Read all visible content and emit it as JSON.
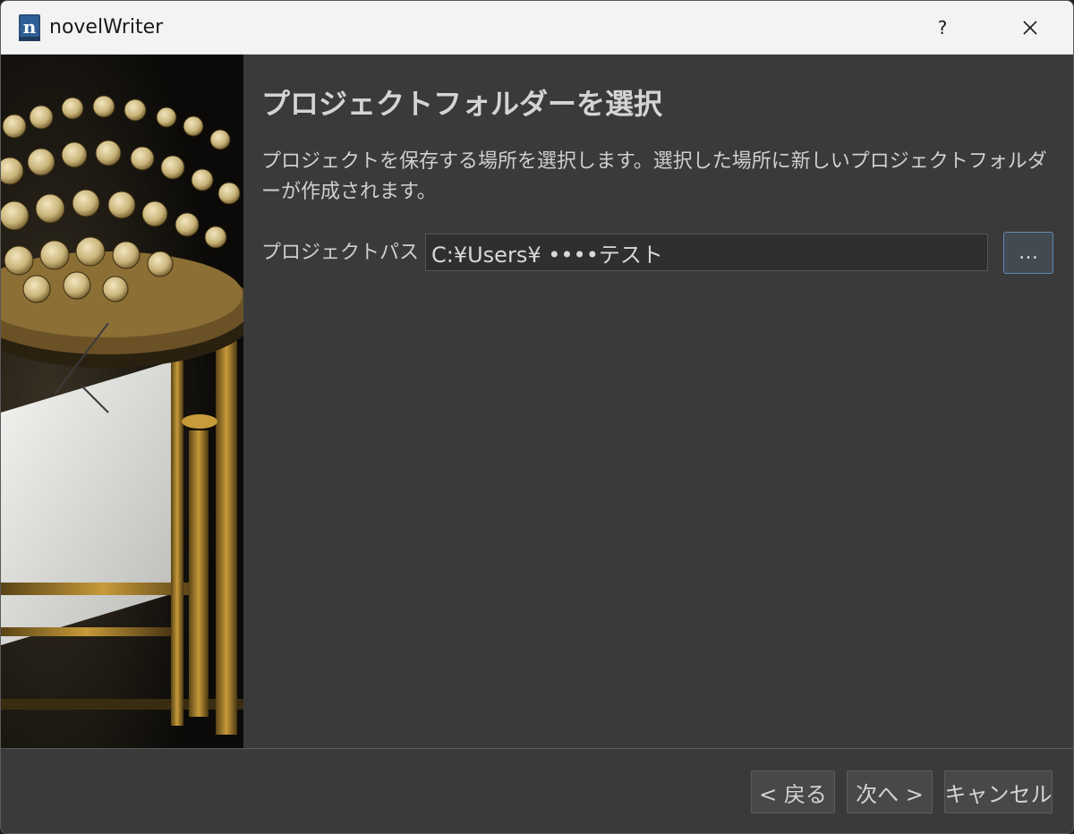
{
  "window": {
    "title": "novelWriter",
    "help_label": "?",
    "icon_name": "novelwriter-logo-icon",
    "close_icon": "close-icon"
  },
  "content": {
    "title": "プロジェクトフォルダーを選択",
    "description": "プロジェクトを保存する場所を選択します。選択した場所に新しいプロジェクトフォルダーが作成されます。",
    "path_label": "プロジェクトパス",
    "path_value": "C:¥Users¥ ••••テスト",
    "browse_label": "…"
  },
  "footer": {
    "back_label": "< 戻る",
    "next_label": "次へ >",
    "cancel_label": "キャンセル"
  },
  "colors": {
    "background": "#3a3a3a",
    "titlebar": "#f3f3f3",
    "accent_border": "#5d89b8",
    "text": "#d4d4d4"
  }
}
